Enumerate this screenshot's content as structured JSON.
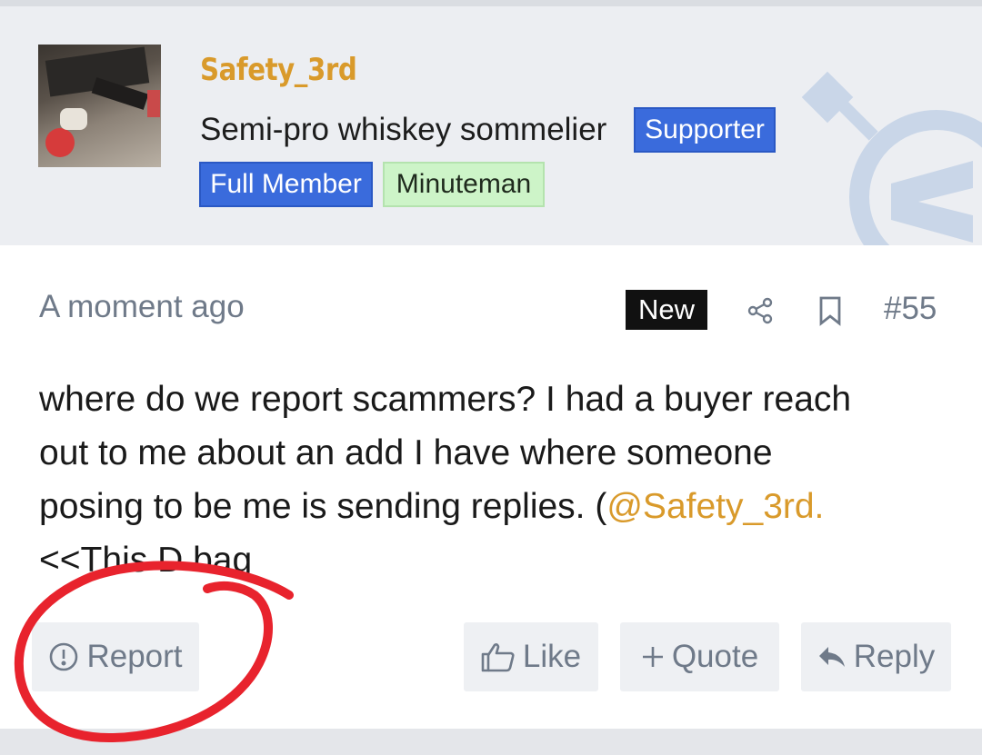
{
  "user": {
    "name": "Safety_3rd",
    "title": "Semi-pro whiskey sommelier",
    "badges": {
      "supporter": "Supporter",
      "full_member": "Full Member",
      "minuteman": "Minuteman"
    }
  },
  "post": {
    "timestamp": "A moment ago",
    "new_label": "New",
    "number": "#55",
    "body": {
      "line1": "where do we report scammers? I had a buyer reach",
      "line2": "out to me about an add I have where someone",
      "line3_text": "posing to be me is sending replies. (",
      "mention": "@Safety_3rd.",
      "line4": "<<This D bag"
    }
  },
  "actions": {
    "report": "Report",
    "like": "Like",
    "quote": "Quote",
    "reply": "Reply"
  },
  "icons": [
    "share-icon",
    "bookmark-icon",
    "alert-circle-icon",
    "thumbs-up-icon",
    "plus-icon",
    "reply-arrow-icon"
  ],
  "colors": {
    "username": "#d99a2b",
    "badge_blue": "#3a6bdc",
    "badge_green": "#cdf4c8",
    "annotation_red": "#e8232d"
  }
}
